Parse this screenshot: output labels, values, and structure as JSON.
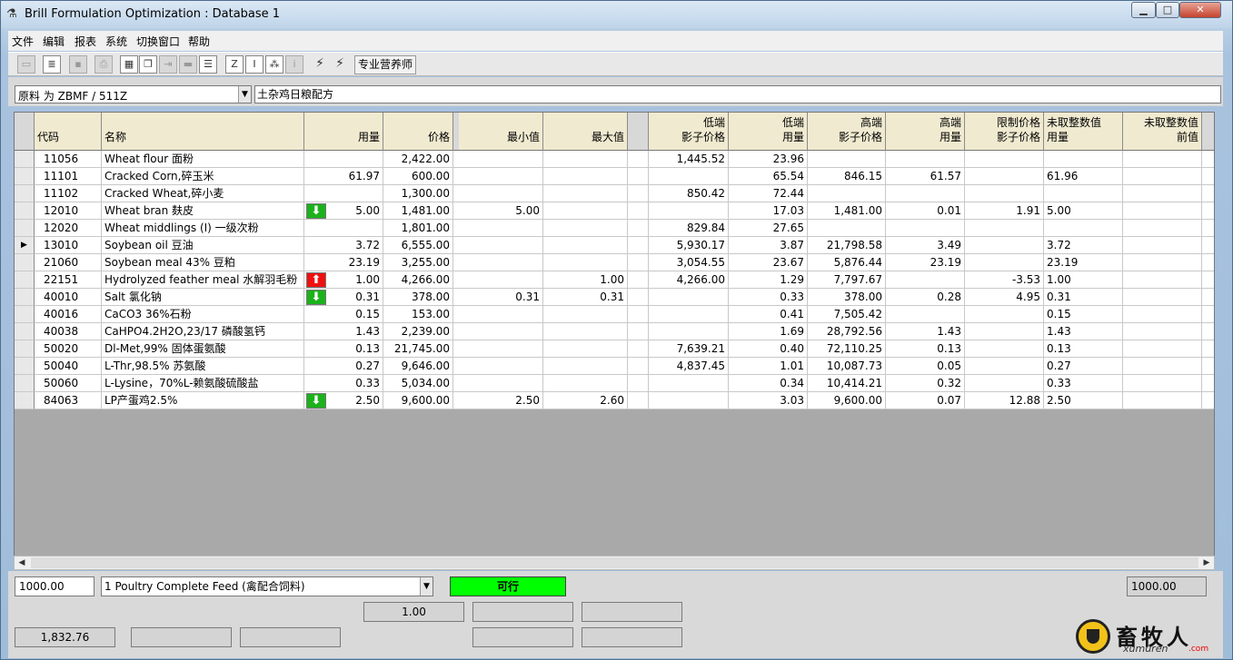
{
  "window": {
    "title": "Brill Formulation Optimization : Database 1"
  },
  "menu": [
    "文件",
    "编辑",
    "报表",
    "系统",
    "切换窗口",
    "帮助"
  ],
  "toolbar": {
    "icons": [
      "open-icon",
      "check-list-icon",
      "save-icon",
      "print-icon",
      "layout-icon",
      "copy-icon",
      "export-icon",
      "folder-icon",
      "properties-icon",
      "z-icon",
      "i-icon",
      "tree-icon",
      "info-icon",
      "lightning-icon",
      "lightning-doc-icon"
    ],
    "text_button": "专业营养师"
  },
  "source": {
    "label": "原料 为 ZBMF / 511Z",
    "formula_name": "土杂鸡日粮配方"
  },
  "columns": {
    "code": "代码",
    "name": "名称",
    "amount": "用量",
    "price": "价格",
    "min": "最小值",
    "max": "最大值",
    "low_shadow": [
      "低端",
      "影子价格"
    ],
    "low_amount": [
      "低端",
      "用量"
    ],
    "high_shadow": [
      "高端",
      "影子价格"
    ],
    "high_amount": [
      "高端",
      "用量"
    ],
    "limit_price": [
      "限制价格",
      "影子价格"
    ],
    "unrounded_amount": [
      "未取整数值",
      "用量"
    ],
    "unrounded_prev": [
      "未取整数值",
      "前值"
    ]
  },
  "rows": [
    {
      "code": "11056",
      "name": "Wheat flour 面粉",
      "arrow": "",
      "amount": "",
      "price": "2,422.00",
      "min": "",
      "max": "",
      "low_shadow": "1,445.52",
      "low_amount": "23.96",
      "high_shadow": "",
      "high_amount": "",
      "limit_price": "",
      "unrounded": "",
      "prev": ""
    },
    {
      "code": "11101",
      "name": "Cracked Corn,碎玉米",
      "arrow": "",
      "amount": "61.97",
      "price": "600.00",
      "min": "",
      "max": "",
      "low_shadow": "",
      "low_amount": "65.54",
      "high_shadow": "846.15",
      "high_amount": "61.57",
      "limit_price": "",
      "unrounded": "61.96",
      "prev": ""
    },
    {
      "code": "11102",
      "name": "Cracked Wheat,碎小麦",
      "arrow": "",
      "amount": "",
      "price": "1,300.00",
      "min": "",
      "max": "",
      "low_shadow": "850.42",
      "low_amount": "72.44",
      "high_shadow": "",
      "high_amount": "",
      "limit_price": "",
      "unrounded": "",
      "prev": ""
    },
    {
      "code": "12010",
      "name": "Wheat bran 麸皮",
      "arrow": "down",
      "amount": "5.00",
      "price": "1,481.00",
      "min": "5.00",
      "max": "",
      "low_shadow": "",
      "low_amount": "17.03",
      "high_shadow": "1,481.00",
      "high_amount": "0.01",
      "limit_price": "1.91",
      "unrounded": "5.00",
      "prev": ""
    },
    {
      "code": "12020",
      "name": "Wheat middlings (I) 一级次粉",
      "arrow": "",
      "amount": "",
      "price": "1,801.00",
      "min": "",
      "max": "",
      "low_shadow": "829.84",
      "low_amount": "27.65",
      "high_shadow": "",
      "high_amount": "",
      "limit_price": "",
      "unrounded": "",
      "prev": ""
    },
    {
      "code": "13010",
      "name": "Soybean oil  豆油",
      "arrow": "",
      "amount": "3.72",
      "price": "6,555.00",
      "min": "",
      "max": "",
      "low_shadow": "5,930.17",
      "low_amount": "3.87",
      "high_shadow": "21,798.58",
      "high_amount": "3.49",
      "limit_price": "",
      "unrounded": "3.72",
      "prev": "",
      "selected": true
    },
    {
      "code": "21060",
      "name": "Soybean meal  43% 豆粕",
      "arrow": "",
      "amount": "23.19",
      "price": "3,255.00",
      "min": "",
      "max": "",
      "low_shadow": "3,054.55",
      "low_amount": "23.67",
      "high_shadow": "5,876.44",
      "high_amount": "23.19",
      "limit_price": "",
      "unrounded": "23.19",
      "prev": ""
    },
    {
      "code": "22151",
      "name": "Hydrolyzed feather meal  水解羽毛粉",
      "arrow": "up",
      "amount": "1.00",
      "price": "4,266.00",
      "min": "",
      "max": "1.00",
      "low_shadow": "4,266.00",
      "low_amount": "1.29",
      "high_shadow": "7,797.67",
      "high_amount": "",
      "limit_price": "-3.53",
      "unrounded": "1.00",
      "prev": ""
    },
    {
      "code": "40010",
      "name": "Salt 氯化钠",
      "arrow": "down",
      "amount": "0.31",
      "price": "378.00",
      "min": "0.31",
      "max": "0.31",
      "low_shadow": "",
      "low_amount": "0.33",
      "high_shadow": "378.00",
      "high_amount": "0.28",
      "limit_price": "4.95",
      "unrounded": "0.31",
      "prev": ""
    },
    {
      "code": "40016",
      "name": "CaCO3 36%石粉",
      "arrow": "",
      "amount": "0.15",
      "price": "153.00",
      "min": "",
      "max": "",
      "low_shadow": "",
      "low_amount": "0.41",
      "high_shadow": "7,505.42",
      "high_amount": "",
      "limit_price": "",
      "unrounded": "0.15",
      "prev": ""
    },
    {
      "code": "40038",
      "name": "CaHPO4.2H2O,23/17 磷酸氢钙",
      "arrow": "",
      "amount": "1.43",
      "price": "2,239.00",
      "min": "",
      "max": "",
      "low_shadow": "",
      "low_amount": "1.69",
      "high_shadow": "28,792.56",
      "high_amount": "1.43",
      "limit_price": "",
      "unrounded": "1.43",
      "prev": ""
    },
    {
      "code": "50020",
      "name": "Dl-Met,99% 固体蛋氨酸",
      "arrow": "",
      "amount": "0.13",
      "price": "21,745.00",
      "min": "",
      "max": "",
      "low_shadow": "7,639.21",
      "low_amount": "0.40",
      "high_shadow": "72,110.25",
      "high_amount": "0.13",
      "limit_price": "",
      "unrounded": "0.13",
      "prev": ""
    },
    {
      "code": "50040",
      "name": "L-Thr,98.5% 苏氨酸",
      "arrow": "",
      "amount": "0.27",
      "price": "9,646.00",
      "min": "",
      "max": "",
      "low_shadow": "4,837.45",
      "low_amount": "1.01",
      "high_shadow": "10,087.73",
      "high_amount": "0.05",
      "limit_price": "",
      "unrounded": "0.27",
      "prev": ""
    },
    {
      "code": "50060",
      "name": "L-Lysine，70%L-赖氨酸硫酸盐",
      "arrow": "",
      "amount": "0.33",
      "price": "5,034.00",
      "min": "",
      "max": "",
      "low_shadow": "",
      "low_amount": "0.34",
      "high_shadow": "10,414.21",
      "high_amount": "0.32",
      "limit_price": "",
      "unrounded": "0.33",
      "prev": ""
    },
    {
      "code": "84063",
      "name": "LP产蛋鸡2.5%",
      "arrow": "down",
      "amount": "2.50",
      "price": "9,600.00",
      "min": "2.50",
      "max": "2.60",
      "low_shadow": "",
      "low_amount": "3.03",
      "high_shadow": "9,600.00",
      "high_amount": "0.07",
      "limit_price": "12.88",
      "unrounded": "2.50",
      "prev": ""
    }
  ],
  "bottom": {
    "batch": "1000.00",
    "feed_type": "1 Poultry Complete Feed  (禽配合饲料)",
    "status": "可行",
    "right_total": "1000.00",
    "mid_value": "1.00",
    "cost": "1,832.76"
  },
  "watermark": {
    "cn": "畜牧人",
    "en": "xumuren",
    "com": ".com"
  }
}
